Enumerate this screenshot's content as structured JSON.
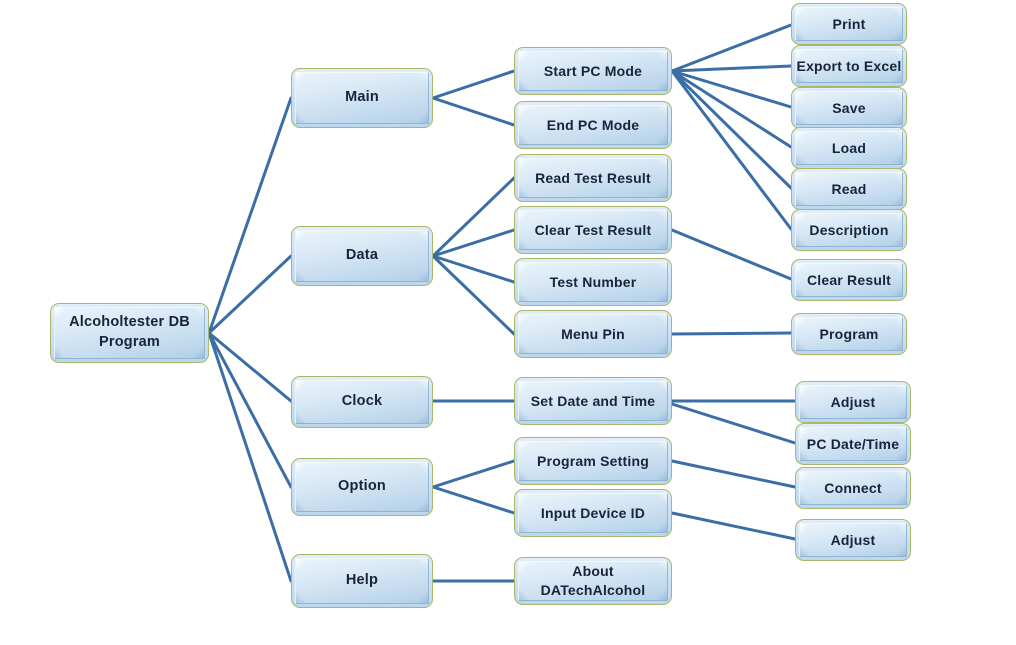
{
  "diagram": {
    "title": "Alcoholtester DB Program menu structure",
    "type": "tree",
    "background_color": "#ffffff",
    "node_border_color": "#a8b86a",
    "node_fill_color": "#cfe2f2",
    "edge_color": "#3b6ea5",
    "text_color": "#17243a"
  },
  "nodes": {
    "root": {
      "label": "Alcoholtester  DB\nProgram"
    },
    "level2": [
      {
        "id": "main",
        "label": "Main"
      },
      {
        "id": "data",
        "label": "Data"
      },
      {
        "id": "clock",
        "label": "Clock"
      },
      {
        "id": "option",
        "label": "Option"
      },
      {
        "id": "help",
        "label": "Help"
      }
    ],
    "level3": [
      {
        "id": "start-pc-mode",
        "label": "Start PC Mode",
        "parent": "main"
      },
      {
        "id": "end-pc-mode",
        "label": "End PC Mode",
        "parent": "main"
      },
      {
        "id": "read-test-result",
        "label": "Read Test Result",
        "parent": "data"
      },
      {
        "id": "clear-test-result",
        "label": "Clear Test Result",
        "parent": "data"
      },
      {
        "id": "test-number",
        "label": "Test Number",
        "parent": "data"
      },
      {
        "id": "menu-pin",
        "label": "Menu Pin",
        "parent": "data"
      },
      {
        "id": "set-date-and-time",
        "label": "Set Date and Time",
        "parent": "clock"
      },
      {
        "id": "program-setting",
        "label": "Program  Setting",
        "parent": "option"
      },
      {
        "id": "input-device-id",
        "label": "Input  Device ID",
        "parent": "option"
      },
      {
        "id": "about-datechalcohol",
        "label": "About DATechAlcohol",
        "parent": "help"
      }
    ],
    "level4": [
      {
        "id": "print",
        "label": "Print",
        "parent": "start-pc-mode"
      },
      {
        "id": "export-to-excel",
        "label": "Export  to Excel",
        "parent": "start-pc-mode"
      },
      {
        "id": "save",
        "label": "Save",
        "parent": "start-pc-mode"
      },
      {
        "id": "load",
        "label": "Load",
        "parent": "start-pc-mode"
      },
      {
        "id": "read",
        "label": "Read",
        "parent": "start-pc-mode"
      },
      {
        "id": "description",
        "label": "Description",
        "parent": "start-pc-mode"
      },
      {
        "id": "clear-result",
        "label": "Clear  Result",
        "parent": "clear-test-result"
      },
      {
        "id": "program",
        "label": "Program",
        "parent": "menu-pin"
      },
      {
        "id": "adjust-clock",
        "label": "Adjust",
        "parent": "set-date-and-time"
      },
      {
        "id": "pc-date-time",
        "label": "PC Date/Time",
        "parent": "set-date-and-time"
      },
      {
        "id": "connect",
        "label": "Connect",
        "parent": "program-setting"
      },
      {
        "id": "adjust-option",
        "label": "Adjust",
        "parent": "input-device-id"
      }
    ]
  }
}
